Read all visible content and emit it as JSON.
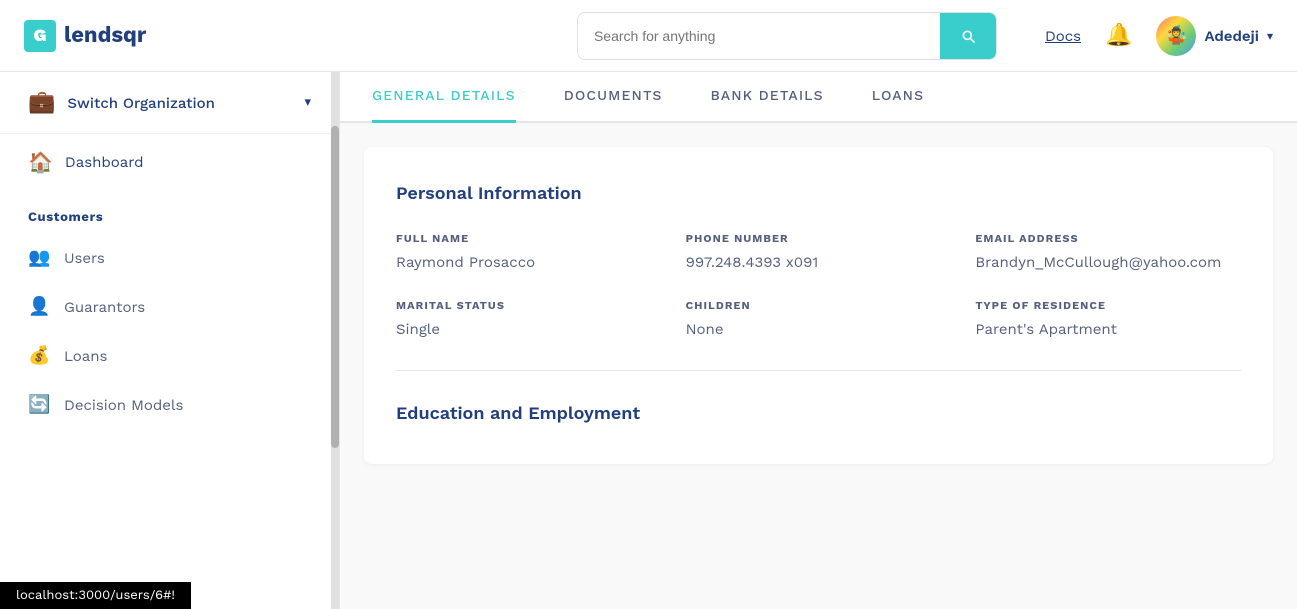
{
  "header": {
    "logo_icon": "G",
    "logo_text": "lendsqr",
    "search_placeholder": "Search for anything",
    "docs_label": "Docs",
    "bell_label": "notifications",
    "avatar_emoji": "🤹",
    "user_name": "Adedeji",
    "user_chevron": "▾"
  },
  "sidebar": {
    "switch_org_label": "Switch Organization",
    "switch_org_chevron": "▾",
    "dashboard_label": "Dashboard",
    "customers_label": "Customers",
    "customers_items": [
      {
        "id": "users",
        "label": "Users",
        "icon": "👥"
      },
      {
        "id": "guarantors",
        "label": "Guarantors",
        "icon": "👤"
      },
      {
        "id": "loans",
        "label": "Loans",
        "icon": "💰"
      },
      {
        "id": "decision-models",
        "label": "Decision Models",
        "icon": "🔄"
      }
    ]
  },
  "tabs": [
    {
      "id": "general-details",
      "label": "General Details",
      "active": true
    },
    {
      "id": "documents",
      "label": "Documents",
      "active": false
    },
    {
      "id": "bank-details",
      "label": "Bank Details",
      "active": false
    },
    {
      "id": "loans",
      "label": "Loans",
      "active": false
    }
  ],
  "personal_info": {
    "section_title": "Personal Information",
    "fields": [
      {
        "label": "Full Name",
        "value": "Raymond Prosacco"
      },
      {
        "label": "Phone Number",
        "value": "997.248.4393 x091"
      },
      {
        "label": "Email Address",
        "value": "Brandyn_McCullough@yahoo.com"
      },
      {
        "label": "Marital Status",
        "value": "Single"
      },
      {
        "label": "Children",
        "value": "None"
      },
      {
        "label": "Type of Residence",
        "value": "Parent's Apartment"
      }
    ]
  },
  "education_section": {
    "title": "Education and Employment"
  },
  "status_bar": {
    "url": "localhost:3000/users/6#!"
  },
  "colors": {
    "accent": "#39cdcc",
    "primary": "#213f7d",
    "text_secondary": "#545f7d"
  }
}
